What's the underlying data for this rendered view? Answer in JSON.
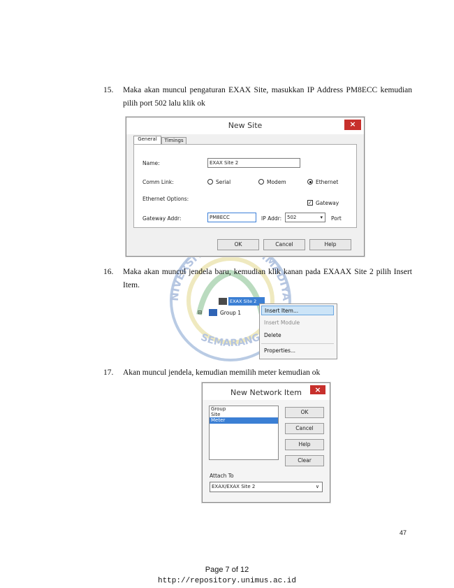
{
  "items": [
    {
      "num": "15.",
      "text": "Maka akan muncul pengaturan EXAX Site, masukkan IP Address PM8ECC kemudian pilih port 502 lalu klik ok"
    },
    {
      "num": "16.",
      "text": "Maka akan muncul jendela baru, kemudian klik kanan pada EXAAX Site 2 pilih Insert Item."
    },
    {
      "num": "17.",
      "text": "Akan muncul jendela, kemudian memilih meter kemudian ok"
    }
  ],
  "new_site": {
    "title": "New Site",
    "close": "×",
    "tabs": [
      "General",
      "Timings"
    ],
    "name_label": "Name:",
    "name_value": "EXAX Site 2",
    "commlink_label": "Comm Link:",
    "radio_serial": "Serial",
    "radio_modem": "Modem",
    "radio_ethernet": "Ethernet",
    "ethernet_options_label": "Ethernet Options:",
    "gateway_check": "Gateway",
    "gateway_addr_label": "Gateway Addr:",
    "gateway_addr_value": "PM8ECC",
    "ip_addr_label": "IP Addr:",
    "ip_addr_value": "502",
    "port_label": "Port",
    "ok": "OK",
    "cancel": "Cancel",
    "help": "Help"
  },
  "context_menu": {
    "tree_site": "EXAX Site 2",
    "tree_group": "Group 1",
    "items": [
      "Insert Item...",
      "Insert Module",
      "Delete",
      "Properties..."
    ]
  },
  "watermark": {
    "top": "UNIVERSITAS MUHAMMADIYAH",
    "bottom": "SEMARANG"
  },
  "new_network_item": {
    "title": "New Network Item",
    "close": "×",
    "list": [
      "Group",
      "Site",
      "Meter"
    ],
    "selected": "Meter",
    "ok": "OK",
    "cancel": "Cancel",
    "help": "Help",
    "clear": "Clear",
    "attach_label": "Attach To",
    "attach_value": "EXAX/EXAX Site 2"
  },
  "page_number": "47",
  "footer": {
    "page": "Page 7 of 12",
    "url": "http://repository.unimus.ac.id"
  }
}
